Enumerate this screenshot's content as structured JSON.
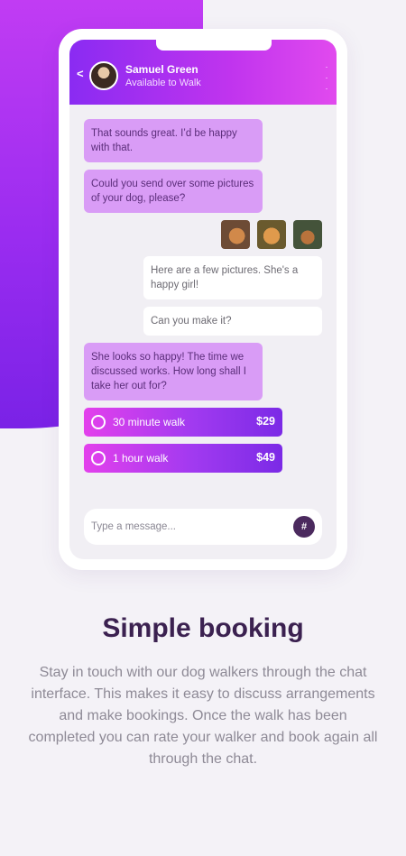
{
  "chat": {
    "contact_name": "Samuel Green",
    "contact_status": "Available to Walk",
    "back_label": "<",
    "menu_label": "·\n·\n·",
    "messages": [
      {
        "from": "in",
        "text": "That sounds great. I’d be happy with that."
      },
      {
        "from": "in",
        "text": "Could you send over some pictures of your dog, please?"
      },
      {
        "from": "out",
        "text": "Here are a few pictures. She's a happy girl!"
      },
      {
        "from": "out",
        "text": "Can you make it?"
      },
      {
        "from": "in",
        "text": "She looks so happy! The time we discussed works. How long shall I take her out for?"
      }
    ],
    "photos": [
      "dog-photo-1",
      "dog-photo-2",
      "dog-photo-3"
    ],
    "options": [
      {
        "label": "30 minute walk",
        "price": "$29"
      },
      {
        "label": "1 hour walk",
        "price": "$49"
      }
    ],
    "input_placeholder": "Type a message...",
    "send_icon": "#"
  },
  "section": {
    "title": "Simple booking",
    "description": "Stay in touch with our dog walkers through the chat interface. This makes it easy to discuss arrangements and make bookings. Once the walk has been completed you can rate your walker and book again all through the chat."
  },
  "colors": {
    "accent_purple": "#8a2bf2",
    "accent_pink": "#e340ec",
    "bubble_in": "#d99cf6",
    "title_color": "#3b2150"
  }
}
